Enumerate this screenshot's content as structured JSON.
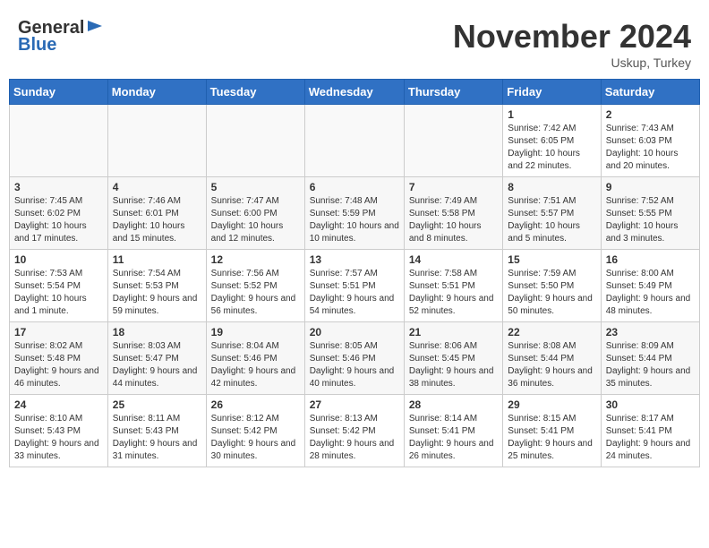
{
  "header": {
    "logo_line1": "General",
    "logo_line2": "Blue",
    "month": "November 2024",
    "location": "Uskup, Turkey"
  },
  "days_of_week": [
    "Sunday",
    "Monday",
    "Tuesday",
    "Wednesday",
    "Thursday",
    "Friday",
    "Saturday"
  ],
  "weeks": [
    [
      {
        "day": "",
        "content": ""
      },
      {
        "day": "",
        "content": ""
      },
      {
        "day": "",
        "content": ""
      },
      {
        "day": "",
        "content": ""
      },
      {
        "day": "",
        "content": ""
      },
      {
        "day": "1",
        "content": "Sunrise: 7:42 AM\nSunset: 6:05 PM\nDaylight: 10 hours and 22 minutes."
      },
      {
        "day": "2",
        "content": "Sunrise: 7:43 AM\nSunset: 6:03 PM\nDaylight: 10 hours and 20 minutes."
      }
    ],
    [
      {
        "day": "3",
        "content": "Sunrise: 7:45 AM\nSunset: 6:02 PM\nDaylight: 10 hours and 17 minutes."
      },
      {
        "day": "4",
        "content": "Sunrise: 7:46 AM\nSunset: 6:01 PM\nDaylight: 10 hours and 15 minutes."
      },
      {
        "day": "5",
        "content": "Sunrise: 7:47 AM\nSunset: 6:00 PM\nDaylight: 10 hours and 12 minutes."
      },
      {
        "day": "6",
        "content": "Sunrise: 7:48 AM\nSunset: 5:59 PM\nDaylight: 10 hours and 10 minutes."
      },
      {
        "day": "7",
        "content": "Sunrise: 7:49 AM\nSunset: 5:58 PM\nDaylight: 10 hours and 8 minutes."
      },
      {
        "day": "8",
        "content": "Sunrise: 7:51 AM\nSunset: 5:57 PM\nDaylight: 10 hours and 5 minutes."
      },
      {
        "day": "9",
        "content": "Sunrise: 7:52 AM\nSunset: 5:55 PM\nDaylight: 10 hours and 3 minutes."
      }
    ],
    [
      {
        "day": "10",
        "content": "Sunrise: 7:53 AM\nSunset: 5:54 PM\nDaylight: 10 hours and 1 minute."
      },
      {
        "day": "11",
        "content": "Sunrise: 7:54 AM\nSunset: 5:53 PM\nDaylight: 9 hours and 59 minutes."
      },
      {
        "day": "12",
        "content": "Sunrise: 7:56 AM\nSunset: 5:52 PM\nDaylight: 9 hours and 56 minutes."
      },
      {
        "day": "13",
        "content": "Sunrise: 7:57 AM\nSunset: 5:51 PM\nDaylight: 9 hours and 54 minutes."
      },
      {
        "day": "14",
        "content": "Sunrise: 7:58 AM\nSunset: 5:51 PM\nDaylight: 9 hours and 52 minutes."
      },
      {
        "day": "15",
        "content": "Sunrise: 7:59 AM\nSunset: 5:50 PM\nDaylight: 9 hours and 50 minutes."
      },
      {
        "day": "16",
        "content": "Sunrise: 8:00 AM\nSunset: 5:49 PM\nDaylight: 9 hours and 48 minutes."
      }
    ],
    [
      {
        "day": "17",
        "content": "Sunrise: 8:02 AM\nSunset: 5:48 PM\nDaylight: 9 hours and 46 minutes."
      },
      {
        "day": "18",
        "content": "Sunrise: 8:03 AM\nSunset: 5:47 PM\nDaylight: 9 hours and 44 minutes."
      },
      {
        "day": "19",
        "content": "Sunrise: 8:04 AM\nSunset: 5:46 PM\nDaylight: 9 hours and 42 minutes."
      },
      {
        "day": "20",
        "content": "Sunrise: 8:05 AM\nSunset: 5:46 PM\nDaylight: 9 hours and 40 minutes."
      },
      {
        "day": "21",
        "content": "Sunrise: 8:06 AM\nSunset: 5:45 PM\nDaylight: 9 hours and 38 minutes."
      },
      {
        "day": "22",
        "content": "Sunrise: 8:08 AM\nSunset: 5:44 PM\nDaylight: 9 hours and 36 minutes."
      },
      {
        "day": "23",
        "content": "Sunrise: 8:09 AM\nSunset: 5:44 PM\nDaylight: 9 hours and 35 minutes."
      }
    ],
    [
      {
        "day": "24",
        "content": "Sunrise: 8:10 AM\nSunset: 5:43 PM\nDaylight: 9 hours and 33 minutes."
      },
      {
        "day": "25",
        "content": "Sunrise: 8:11 AM\nSunset: 5:43 PM\nDaylight: 9 hours and 31 minutes."
      },
      {
        "day": "26",
        "content": "Sunrise: 8:12 AM\nSunset: 5:42 PM\nDaylight: 9 hours and 30 minutes."
      },
      {
        "day": "27",
        "content": "Sunrise: 8:13 AM\nSunset: 5:42 PM\nDaylight: 9 hours and 28 minutes."
      },
      {
        "day": "28",
        "content": "Sunrise: 8:14 AM\nSunset: 5:41 PM\nDaylight: 9 hours and 26 minutes."
      },
      {
        "day": "29",
        "content": "Sunrise: 8:15 AM\nSunset: 5:41 PM\nDaylight: 9 hours and 25 minutes."
      },
      {
        "day": "30",
        "content": "Sunrise: 8:17 AM\nSunset: 5:41 PM\nDaylight: 9 hours and 24 minutes."
      }
    ]
  ]
}
